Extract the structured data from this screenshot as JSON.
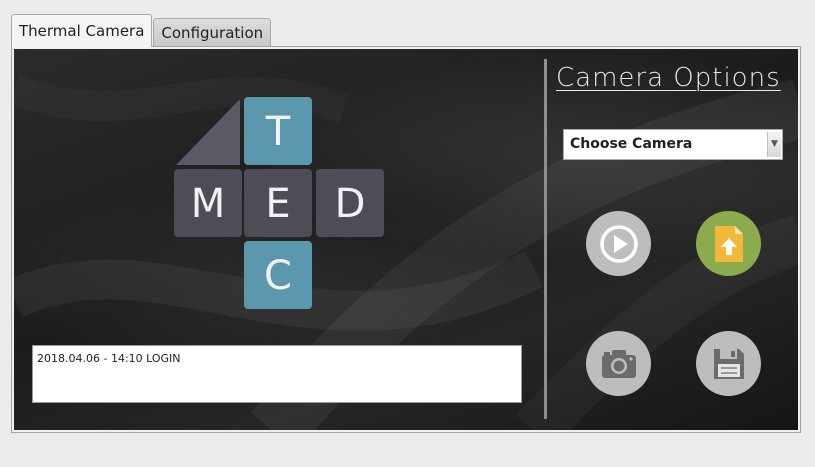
{
  "tabs": [
    {
      "label": "Thermal Camera",
      "active": true
    },
    {
      "label": "Configuration",
      "active": false
    }
  ],
  "logo": {
    "letters": [
      "T",
      "M",
      "E",
      "D",
      "C"
    ],
    "colors": {
      "accent": "#5b97ad",
      "tile": "#4e4d57"
    }
  },
  "log": {
    "entries": [
      "2018.04.06  -  14:10 LOGIN"
    ]
  },
  "camera_options": {
    "title": "Camera Options",
    "select": {
      "value": "Choose Camera"
    },
    "buttons": [
      {
        "name": "play",
        "icon": "play-icon"
      },
      {
        "name": "upload",
        "icon": "file-upload-icon"
      },
      {
        "name": "capture",
        "icon": "camera-icon"
      },
      {
        "name": "save",
        "icon": "floppy-disk-icon"
      }
    ]
  },
  "colors": {
    "upload_bg": "#8cab4f",
    "upload_file": "#f1b83c",
    "round_bg": "#bdbdbd"
  }
}
